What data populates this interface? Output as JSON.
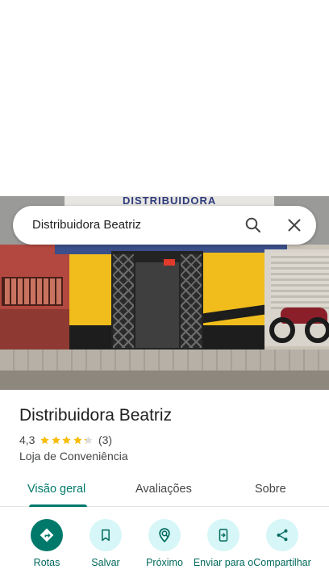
{
  "search": {
    "query": "Distribuidora Beatriz"
  },
  "photo": {
    "sign_text": "DISTRIBUIDORA",
    "led_text": "ABER"
  },
  "place": {
    "title": "Distribuidora Beatriz",
    "rating": "4,3",
    "stars": 4.3,
    "review_count": "(3)",
    "category": "Loja de Conveniência"
  },
  "tabs": [
    {
      "label": "Visão geral",
      "active": true
    },
    {
      "label": "Avaliações",
      "active": false
    },
    {
      "label": "Sobre",
      "active": false
    }
  ],
  "actions": [
    {
      "label": "Rotas",
      "icon": "directions-icon"
    },
    {
      "label": "Salvar",
      "icon": "bookmark-icon"
    },
    {
      "label": "Próximo",
      "icon": "nearby-icon"
    },
    {
      "label": "Enviar para o",
      "icon": "send-to-phone-icon"
    },
    {
      "label": "Compartilhar",
      "icon": "share-icon"
    }
  ],
  "colors": {
    "accent": "#00796b",
    "action_bg": "#d6f6f7",
    "star": "#fbbc04"
  }
}
